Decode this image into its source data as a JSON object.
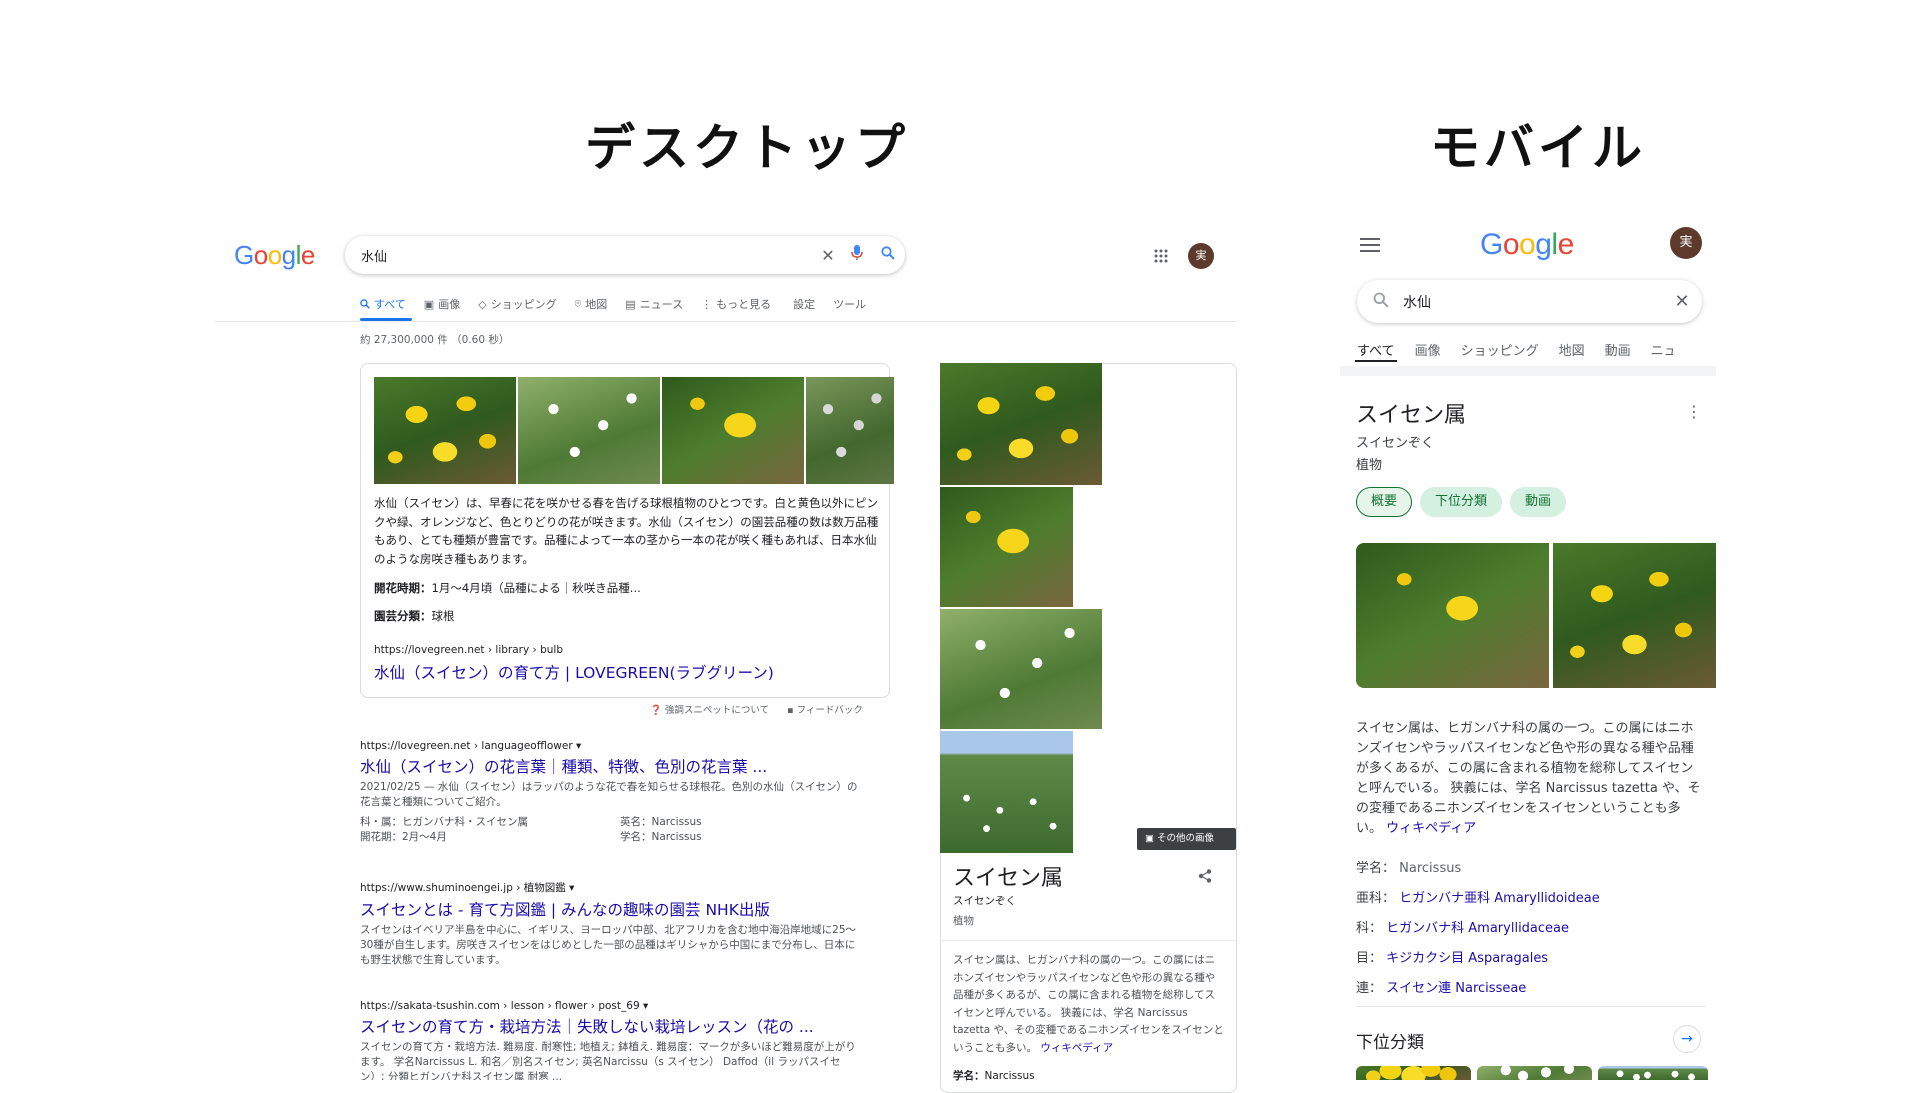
{
  "headings": {
    "desktop": "デスクトップ",
    "mobile": "モバイル"
  },
  "desktop": {
    "logo": [
      "G",
      "o",
      "o",
      "g",
      "l",
      "e"
    ],
    "search": {
      "query": "水仙"
    },
    "tabs": [
      {
        "label": "すべて",
        "icon": "search-icon"
      },
      {
        "label": "画像",
        "icon": "image-icon"
      },
      {
        "label": "ショッピング",
        "icon": "tag-icon"
      },
      {
        "label": "地図",
        "icon": "map-pin-icon"
      },
      {
        "label": "ニュース",
        "icon": "news-icon"
      },
      {
        "label": "もっと見る",
        "icon": "more-vert-icon"
      },
      {
        "label": "設定"
      },
      {
        "label": "ツール"
      }
    ],
    "result_stats": "約 27,300,000 件 （0.60 秒）",
    "featured": {
      "paragraph": "水仙（スイセン）は、早春に花を咲かせる春を告げる球根植物のひとつです。白と黄色以外にピンクや緑、オレンジなど、色とりどりの花が咲きます。水仙（スイセン）の園芸品種の数は数万品種もあり、とても種類が豊富です。品種によって一本の茎から一本の花が咲く種もあれば、日本水仙のような房咲き種もあります。",
      "fact1_label": "開花時期：",
      "fact1_value": "1月〜4月頃（品種による｜秋咲き品種...",
      "fact2_label": "園芸分類：",
      "fact2_value": "球根",
      "url": "https://lovegreen.net › library › bulb",
      "title": "水仙（スイセン）の育て方 | LOVEGREEN(ラブグリーン)",
      "about": "強調スニペットについて",
      "feedback": "フィードバック"
    },
    "results": [
      {
        "url": "https://lovegreen.net › languageofflower ▾",
        "title": "水仙（スイセン）の花言葉｜種類、特徴、色別の花言葉 ...",
        "text": "2021/02/25 — 水仙（スイセン）はラッパのような花で春を知らせる球根花。色別の水仙（スイセン）の花言葉と種類についてご紹介。",
        "extra": [
          {
            "label": "科・属：",
            "value": "ヒガンバナ科・スイセン属"
          },
          {
            "label": "英名：",
            "value": "Narcissus"
          },
          {
            "label": "開花期：",
            "value": "2月〜4月"
          },
          {
            "label": "学名：",
            "value": "Narcissus"
          }
        ]
      },
      {
        "url": "https://www.shuminoengei.jp › 植物図鑑 ▾",
        "title": "スイセンとは - 育て方図鑑 | みんなの趣味の園芸 NHK出版",
        "text": "スイセンはイベリア半島を中心に、イギリス、ヨーロッパ中部、北アフリカを含む地中海沿岸地域に25〜30種が自生します。房咲きスイセンをはじめとした一部の品種はギリシャから中国にまで分布し、日本にも野生状態で生育しています。"
      },
      {
        "url": "https://sakata-tsushin.com › lesson › flower › post_69 ▾",
        "title": "スイセンの育て方・栽培方法｜失敗しない栽培レッスン（花の ...",
        "text": "スイセンの育て方・栽培方法. 難易度. 耐寒性; 地植え; 鉢植え. 難易度：マークが多いほど難易度が上がります。 学名Narcissus L. 和名／別名スイセン; 英名Narcissu（s スイセン） Daffod（il ラッパスイセン）; 分類ヒガンバナ科スイセン属 耐寒 ..."
      }
    ],
    "kp": {
      "more_images": "その他の画像",
      "title": "スイセン属",
      "reading": "スイセンぞく",
      "type": "植物",
      "description": "スイセン属は、ヒガンバナ科の属の一つ。この属にはニホンズイセンやラッパスイセンなど色や形の異なる種や品種が多くあるが、この属に含まれる植物を総称してスイセンと呼んでいる。 狭義には、学名 Narcissus tazetta や、その変種であるニホンズイセンをスイセンということも多い。",
      "wiki": "ウィキペディア",
      "sci_label": "学名：",
      "sci_value": "Narcissus"
    }
  },
  "mobile": {
    "logo": [
      "G",
      "o",
      "o",
      "g",
      "l",
      "e"
    ],
    "avatar": "実",
    "search": {
      "query": "水仙"
    },
    "tabs": [
      "すべて",
      "画像",
      "ショッピング",
      "地図",
      "動画",
      "ニュ"
    ],
    "kp": {
      "title": "スイセン属",
      "reading": "スイセンぞく",
      "type": "植物",
      "chips": [
        "概要",
        "下位分類",
        "動画"
      ],
      "description": "スイセン属は、ヒガンバナ科の属の一つ。この属にはニホンズイセンやラッパスイセンなど色や形の異なる種や品種が多くあるが、この属に含まれる植物を総称してスイセンと呼んでいる。 狭義には、学名 Narcissus tazetta や、その変種であるニホンズイセンをスイセンということも多い。",
      "wiki": "ウィキペディア",
      "facts": [
        {
          "label": "学名：",
          "value": "Narcissus",
          "link": false
        },
        {
          "label": "亜科：",
          "value": "ヒガンバナ亜科 Amaryllidoideae",
          "link": true
        },
        {
          "label": "科：",
          "value": "ヒガンバナ科 Amaryllidaceae",
          "link": true
        },
        {
          "label": "目：",
          "value": "キジカクシ目 Asparagales",
          "link": true
        },
        {
          "label": "連：",
          "value": "スイセン連 Narcisseae",
          "link": true
        }
      ],
      "subclass_title": "下位分類"
    }
  },
  "colors": {
    "link": "#1a0dab",
    "accent": "#1a73e8",
    "chip_bg": "#d3f0e0",
    "chip_text": "#137333",
    "avatar_bg": "#5d3a2b"
  }
}
